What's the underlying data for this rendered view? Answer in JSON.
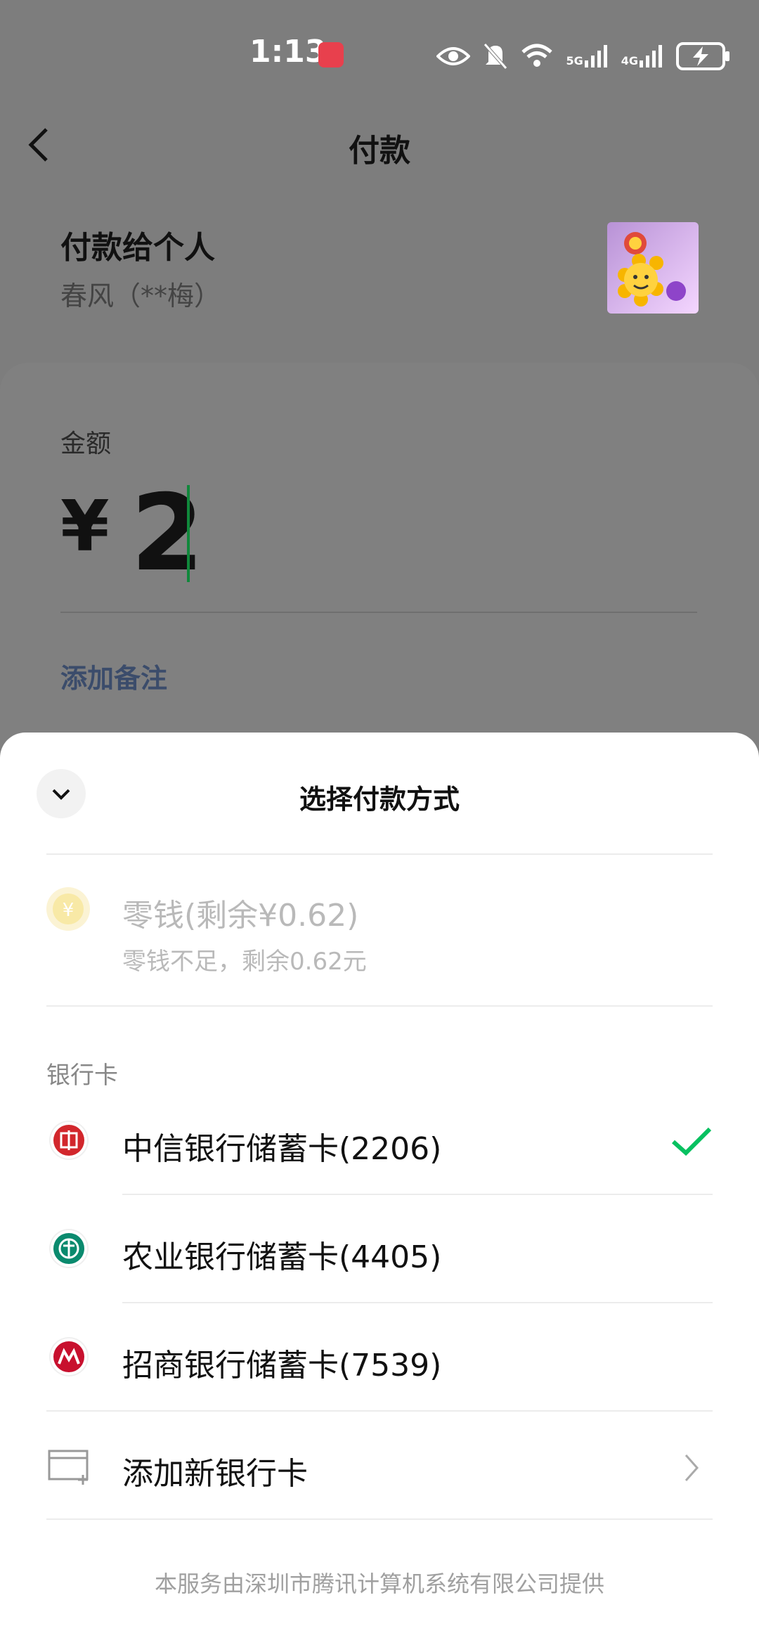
{
  "status_bar": {
    "time": "1:13",
    "signal_5g_label": "5G",
    "signal_4g_label": "4G"
  },
  "header": {
    "title": "付款",
    "back_icon": "chevron-left-icon"
  },
  "payee": {
    "title": "付款给个人",
    "name": "春风（**梅）"
  },
  "amount": {
    "label": "金额",
    "currency": "¥",
    "value": "2",
    "add_note": "添加备注"
  },
  "payment_sheet": {
    "title": "选择付款方式",
    "collapse_icon": "chevron-down-icon",
    "balance": {
      "title": "零钱(剩余¥0.62)",
      "note": "零钱不足，剩余0.62元",
      "disabled": true
    },
    "section_label": "银行卡",
    "bank_cards": [
      {
        "label": "中信银行储蓄卡(2206)",
        "icon": "citic-bank-icon",
        "selected": true,
        "color": "#d2272c"
      },
      {
        "label": "农业银行储蓄卡(4405)",
        "icon": "abc-bank-icon",
        "selected": false,
        "color": "#0a8a6e"
      },
      {
        "label": "招商银行储蓄卡(7539)",
        "icon": "cmb-bank-icon",
        "selected": false,
        "color": "#c8102e"
      }
    ],
    "add_card": "添加新银行卡",
    "footer": "本服务由深圳市腾讯计算机系统有限公司提供"
  },
  "colors": {
    "accent_green": "#07c160",
    "overlay_gray": "#7d7d7d"
  }
}
